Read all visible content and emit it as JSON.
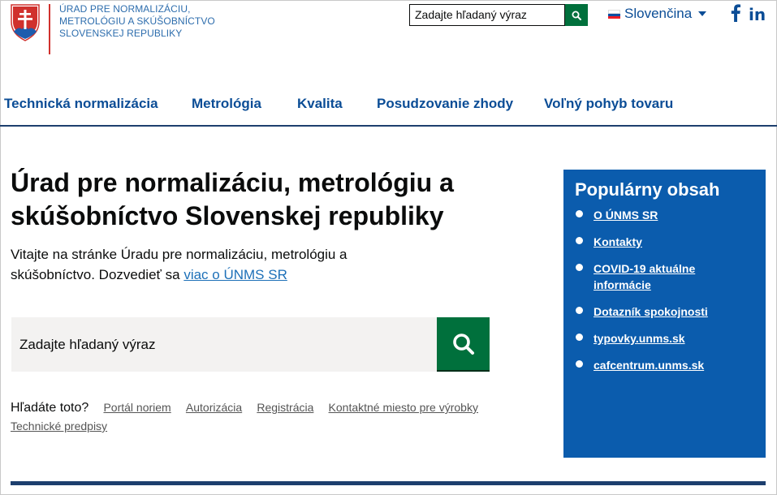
{
  "header": {
    "logo_lines": [
      "ÚRAD PRE NORMALIZÁCIU,",
      "METROLÓGIU A SKÚŠOBNÍCTVO",
      "SLOVENSKEJ REPUBLIKY"
    ],
    "search_placeholder": "Zadajte hľadaný výraz",
    "language": "Slovenčina",
    "social_linkedin": "in"
  },
  "nav": {
    "items": [
      "Technická normalizácia",
      "Metrológia",
      "Kvalita",
      "Posudzovanie zhody",
      "Voľný pohyb tovaru"
    ]
  },
  "main": {
    "title": "Úrad pre normalizáciu, metrológiu a skúšobníctvo Slovenskej republiky",
    "intro_text": "Vitajte na stránke Úradu pre normalizáciu, metrológiu a skúšobníctvo. Dozvedieť sa",
    "intro_link": "viac o ÚNMS SR",
    "search_placeholder": "Zadajte hľadaný výraz",
    "quick_label": "Hľadáte toto?",
    "quick_links": [
      "Portál noriem",
      "Autorizácia",
      "Registrácia",
      "Kontaktné miesto pre výrobky",
      "Technické predpisy"
    ]
  },
  "popular": {
    "title": "Populárny obsah",
    "items": [
      "O ÚNMS SR",
      "Kontakty",
      "COVID-19 aktuálne informácie",
      "Dotazník spokojnosti",
      "typovky.unms.sk",
      "cafcentrum.unms.sk"
    ]
  },
  "colors": {
    "brand_blue": "#0b4d96",
    "popular_bg": "#0b5cad",
    "search_green": "#00703c",
    "rule_navy": "#1d3f6e"
  },
  "icons": {
    "top_search": "search-icon",
    "main_search": "search-icon",
    "facebook": "facebook-icon",
    "linkedin": "linkedin-icon",
    "flag": "slovak-flag-icon",
    "emblem": "coat-of-arms-icon"
  }
}
